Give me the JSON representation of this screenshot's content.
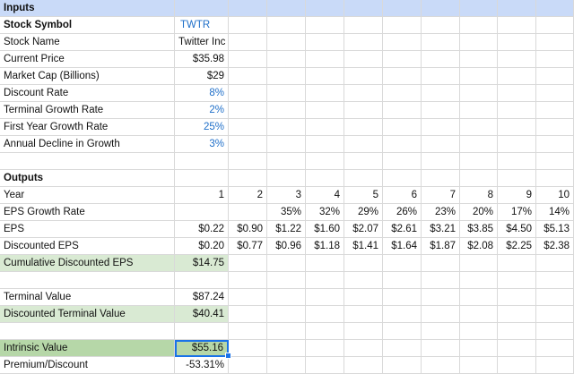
{
  "inputs": {
    "header": "Inputs",
    "rows": [
      {
        "label": "Stock Symbol",
        "value": "TWTR"
      },
      {
        "label": "Stock Name",
        "value": "Twitter Inc"
      },
      {
        "label": "Current Price",
        "value": "$35.98"
      },
      {
        "label": "Market Cap (Billions)",
        "value": "$29"
      },
      {
        "label": "Discount Rate",
        "value": "8%"
      },
      {
        "label": "Terminal Growth Rate",
        "value": "2%"
      },
      {
        "label": "First Year Growth Rate",
        "value": "25%"
      },
      {
        "label": "Annual Decline in Growth",
        "value": "3%"
      }
    ]
  },
  "outputs": {
    "header": "Outputs",
    "year": {
      "label": "Year",
      "values": [
        "1",
        "2",
        "3",
        "4",
        "5",
        "6",
        "7",
        "8",
        "9",
        "10"
      ]
    },
    "eps_growth": {
      "label": "EPS Growth Rate",
      "values": [
        "",
        "",
        "35%",
        "32%",
        "29%",
        "26%",
        "23%",
        "20%",
        "17%",
        "14%"
      ]
    },
    "eps": {
      "label": "EPS",
      "values": [
        "$0.22",
        "$0.90",
        "$1.22",
        "$1.60",
        "$2.07",
        "$2.61",
        "$3.21",
        "$3.85",
        "$4.50",
        "$5.13"
      ]
    },
    "discounted_eps": {
      "label": "Discounted EPS",
      "values": [
        "$0.20",
        "$0.77",
        "$0.96",
        "$1.18",
        "$1.41",
        "$1.64",
        "$1.87",
        "$2.08",
        "$2.25",
        "$2.38"
      ]
    },
    "cumulative_discounted_eps": {
      "label": "Cumulative Discounted EPS",
      "value": "$14.75"
    },
    "terminal_value": {
      "label": "Terminal Value",
      "value": "$87.24"
    },
    "discounted_terminal_value": {
      "label": "Discounted Terminal Value",
      "value": "$40.41"
    },
    "intrinsic_value": {
      "label": "Intrinsic Value",
      "value": "$55.16"
    },
    "premium_discount": {
      "label": "Premium/Discount",
      "value": "-53.31%"
    }
  },
  "colors": {
    "header_fill": "#c9daf8",
    "light_green_fill": "#d9ead3",
    "medium_green_fill": "#b6d7a8",
    "input_text_blue": "#1f6fc9",
    "selection_blue": "#1a73e8",
    "gridline": "#d9d9d9"
  }
}
